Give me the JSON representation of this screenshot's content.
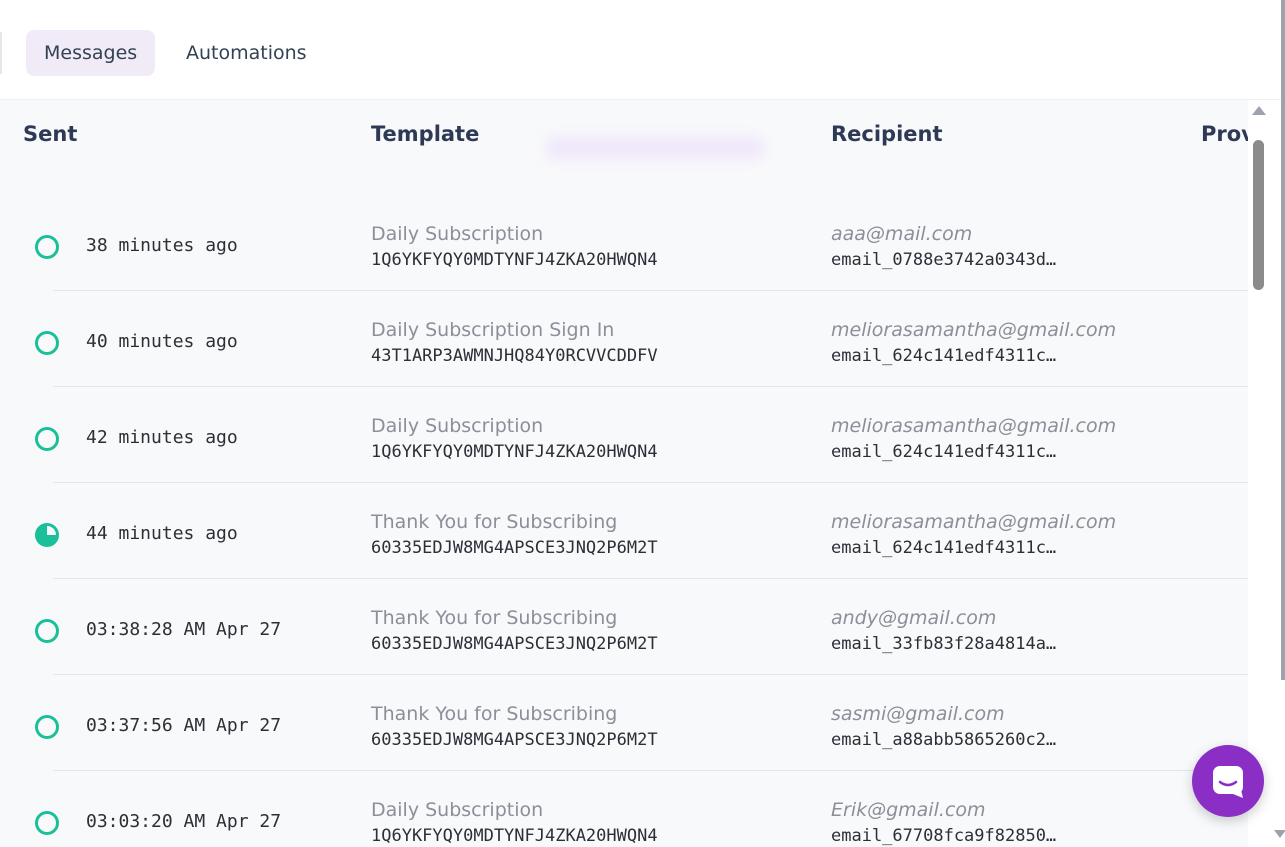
{
  "tabs": [
    {
      "label": "Messages",
      "active": true
    },
    {
      "label": "Automations",
      "active": false
    }
  ],
  "table": {
    "headers": {
      "sent": "Sent",
      "template": "Template",
      "recipient": "Recipient",
      "provider": "Prov"
    },
    "rows": [
      {
        "status": "delivered",
        "time": "38 minutes ago",
        "template_name": "Daily Subscription",
        "template_id": "1Q6YKFYQY0MDTYNFJ4ZKA20HWQN4",
        "recipient_email": "aaa@mail.com",
        "recipient_id": "email_0788e3742a0343d…"
      },
      {
        "status": "delivered",
        "time": "40 minutes ago",
        "template_name": "Daily Subscription Sign In",
        "template_id": "43T1ARP3AWMNJHQ84Y0RCVVCDDFV",
        "recipient_email": "meliorasamantha@gmail.com",
        "recipient_id": "email_624c141edf4311c…"
      },
      {
        "status": "delivered",
        "time": "42 minutes ago",
        "template_name": "Daily Subscription",
        "template_id": "1Q6YKFYQY0MDTYNFJ4ZKA20HWQN4",
        "recipient_email": "meliorasamantha@gmail.com",
        "recipient_id": "email_624c141edf4311c…"
      },
      {
        "status": "partial",
        "time": "44 minutes ago",
        "template_name": "Thank You for Subscribing",
        "template_id": "60335EDJW8MG4APSCE3JNQ2P6M2T",
        "recipient_email": "meliorasamantha@gmail.com",
        "recipient_id": "email_624c141edf4311c…"
      },
      {
        "status": "delivered",
        "time": "03:38:28 AM Apr 27",
        "template_name": "Thank You for Subscribing",
        "template_id": "60335EDJW8MG4APSCE3JNQ2P6M2T",
        "recipient_email": "andy@gmail.com",
        "recipient_id": "email_33fb83f28a4814a…"
      },
      {
        "status": "delivered",
        "time": "03:37:56 AM Apr 27",
        "template_name": "Thank You for Subscribing",
        "template_id": "60335EDJW8MG4APSCE3JNQ2P6M2T",
        "recipient_email": "sasmi@gmail.com",
        "recipient_id": "email_a88abb5865260c2…"
      },
      {
        "status": "delivered",
        "time": "03:03:20 AM Apr 27",
        "template_name": "Daily Subscription",
        "template_id": "1Q6YKFYQY0MDTYNFJ4ZKA20HWQN4",
        "recipient_email": "Erik@gmail.com",
        "recipient_id": "email_67708fca9f82850…"
      }
    ]
  },
  "colors": {
    "accent": "#8a2ec6",
    "status_ok": "#1bbf9a",
    "active_tab_bg": "#f1ebf8"
  },
  "icons": {
    "chat": "chat-bubble-icon",
    "status": "status-circle-icon"
  }
}
